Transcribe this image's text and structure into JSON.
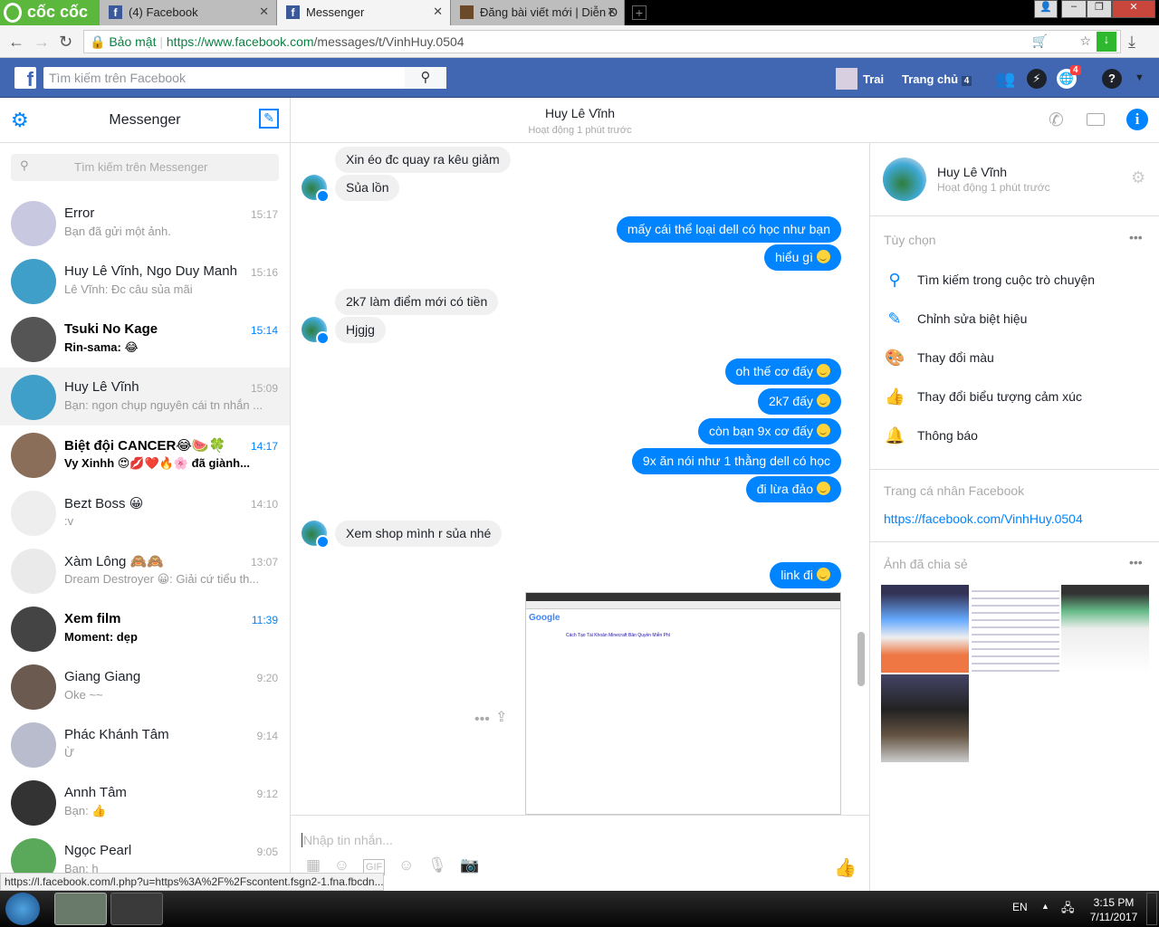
{
  "browser": {
    "brand": "cốc cốc",
    "tabs": [
      {
        "label": "(4) Facebook"
      },
      {
        "label": "Messenger"
      },
      {
        "label": "Đăng bài viết mới | Diễn Đ"
      }
    ],
    "secure_label": "Bảo mật",
    "url_host": "https://www.facebook.com",
    "url_path": "/messages/t/VinhHuy.0504"
  },
  "fb": {
    "search_placeholder": "Tìm kiếm trên Facebook",
    "profile_name": "Trai",
    "home_label": "Trang chủ",
    "home_count": "4",
    "notif_count": "4"
  },
  "sidebar": {
    "title": "Messenger",
    "search_placeholder": "Tìm kiếm trên Messenger",
    "conversations": [
      {
        "name": "Error",
        "snippet": "Bạn đã gửi một ảnh.",
        "time": "15:17",
        "unread": false,
        "color": "#c8c8e0"
      },
      {
        "name": "Huy Lê Vĩnh, Ngo Duy Manh",
        "snippet": "Lê Vĩnh: Đc câu sủa mãi",
        "time": "15:16",
        "unread": false,
        "color": "#3f9fc8"
      },
      {
        "name": "Tsuki No Kage",
        "snippet": "Rin-sama: 😂",
        "time": "15:14",
        "unread": true,
        "color": "#555"
      },
      {
        "name": "Huy Lê Vĩnh",
        "snippet": "Bạn: ngon chụp nguyên cái tn nhắn ...",
        "time": "15:09",
        "unread": false,
        "active": true,
        "color": "#3f9fc8"
      },
      {
        "name": "Biệt đội CANCER😂🍉🍀",
        "snippet": "Vy Xinhh 😍💋❤️🔥🌸 đã giành...",
        "time": "14:17",
        "unread": true,
        "color": "#8a6e5a"
      },
      {
        "name": "Bezt Boss 😀",
        "snippet": ":v",
        "time": "14:10",
        "unread": false,
        "color": "#eee"
      },
      {
        "name": "Xàm Lông 🙈🙈",
        "snippet": "Dream Destroyer 😀: Giải cứ tiểu th...",
        "time": "13:07",
        "unread": false,
        "color": "#eaeaea"
      },
      {
        "name": "Xem film",
        "snippet": "Moment: dẹp",
        "time": "11:39",
        "unread": true,
        "color": "#444"
      },
      {
        "name": "Giang Giang",
        "snippet": "Oke ~~",
        "time": "9:20",
        "unread": false,
        "color": "#6a5a50"
      },
      {
        "name": "Phác Khánh Tâm",
        "snippet": "Ừ",
        "time": "9:14",
        "unread": false,
        "color": "#b8bccc"
      },
      {
        "name": "Annh Tâm",
        "snippet": "Bạn: 👍",
        "time": "9:12",
        "unread": false,
        "color": "#333"
      },
      {
        "name": "Ngọc Pearl",
        "snippet": "Bạn: h",
        "time": "9:05",
        "unread": false,
        "color": "#5aa85a"
      }
    ]
  },
  "chat": {
    "name": "Huy Lê Vĩnh",
    "status": "Hoạt động 1 phút trước",
    "messages": [
      {
        "text": "Xin éo đc quay ra kêu giảm"
      },
      {
        "text": "Sủa lồn"
      },
      {
        "text": "mấy cái thể loại dell có học như bạn"
      },
      {
        "text": "hiểu gì"
      },
      {
        "text": "2k7 làm điểm mới có tiền"
      },
      {
        "text": "Hjgjg"
      },
      {
        "text": "oh thế cơ đấy"
      },
      {
        "text": "2k7 đấy"
      },
      {
        "text": "còn bạn 9x cơ đấy"
      },
      {
        "text": "9x ăn nói như 1 thằng dell có học"
      },
      {
        "text": "đi lừa đảo"
      },
      {
        "text": "Xem shop mình r sủa nhé"
      },
      {
        "text": "link đi"
      }
    ],
    "input_placeholder": "Nhập tin nhắn...",
    "image_caption": "Cách Tạo Tài Khoản Minecraft Bản Quyền Miễn Phí"
  },
  "info": {
    "name": "Huy Lê Vĩnh",
    "status": "Hoạt động 1 phút trước",
    "options_title": "Tùy chọn",
    "options": [
      "Tìm kiếm trong cuộc trò chuyện",
      "Chỉnh sửa biệt hiệu",
      "Thay đổi màu",
      "Thay đổi biểu tượng cảm xúc",
      "Thông báo"
    ],
    "profile_title": "Trang cá nhân Facebook",
    "profile_link": "https://facebook.com/VinhHuy.0504",
    "photos_title": "Ảnh đã chia sẻ"
  },
  "status_url": "https://l.facebook.com/l.php?u=https%3A%2F%2Fscontent.fsgn2-1.fna.fbcdn....",
  "taskbar": {
    "lang": "EN",
    "time": "3:15 PM",
    "date": "7/11/2017"
  },
  "colors": {
    "fb_blue": "#4267b2",
    "messenger_blue": "#0084ff",
    "bubble_grey": "#f1f0f0"
  }
}
